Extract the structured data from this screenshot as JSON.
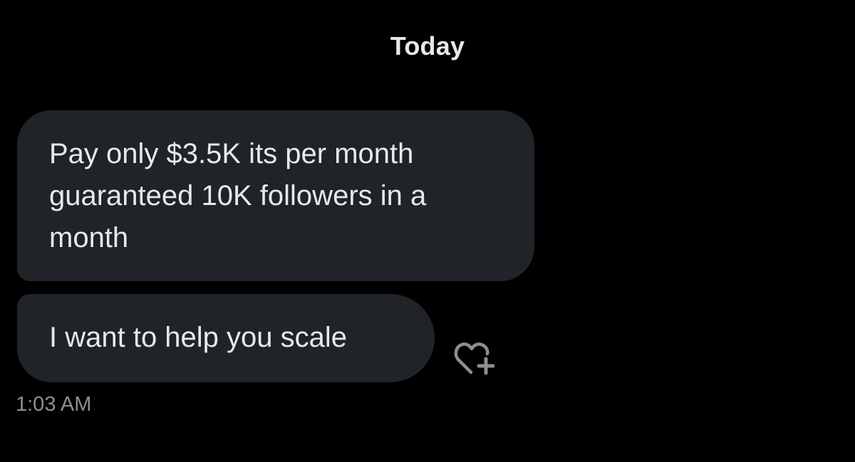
{
  "conversation": {
    "date_divider": "Today",
    "messages": [
      {
        "text": "Pay only $3.5K its per month guaranteed 10K followers in a month"
      },
      {
        "text": "I want to help you scale"
      }
    ],
    "timestamp": "1:03 AM"
  },
  "icons": {
    "react": "heart-plus-icon"
  },
  "colors": {
    "background": "#000000",
    "bubble": "#202327",
    "text": "#e7e9ea",
    "muted": "#8b8f94"
  }
}
